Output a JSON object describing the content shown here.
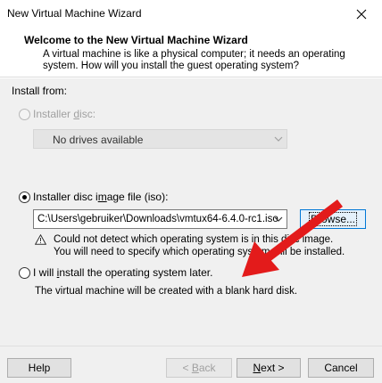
{
  "window": {
    "title": "New Virtual Machine Wizard",
    "close_icon": "close-icon"
  },
  "header": {
    "title": "Welcome to the New Virtual Machine Wizard",
    "description_line1": "A virtual machine is like a physical computer; it needs an operating",
    "description_line2": "system. How will you install the guest operating system?"
  },
  "install_from": {
    "label": "Install from:",
    "installer_disc": {
      "label_pre": "Installer ",
      "label_ul": "d",
      "label_post": "isc:",
      "enabled": false,
      "selected": false,
      "dropdown_value": "No drives available"
    },
    "iso": {
      "label_pre": "Installer disc i",
      "label_ul": "m",
      "label_post": "age file (iso):",
      "selected": true,
      "path": "C:\\Users\\gebruiker\\Downloads\\vmtux64-6.4.0-rc1.iso",
      "browse_label": "Browse...",
      "warning_line1": "Could not detect which operating system is in this disc image.",
      "warning_line2": "You will need to specify which operating system will be installed."
    },
    "later": {
      "label_pre": "I will ",
      "label_ul": "i",
      "label_post": "nstall the operating system later.",
      "selected": false,
      "description": "The virtual machine will be created with a blank hard disk."
    }
  },
  "footer": {
    "help_label": "Help",
    "back_label": "< Back",
    "next_label": "Next >",
    "cancel_label": "Cancel"
  },
  "colors": {
    "arrow": "#e31b1b",
    "focus_border": "#0078d7"
  }
}
